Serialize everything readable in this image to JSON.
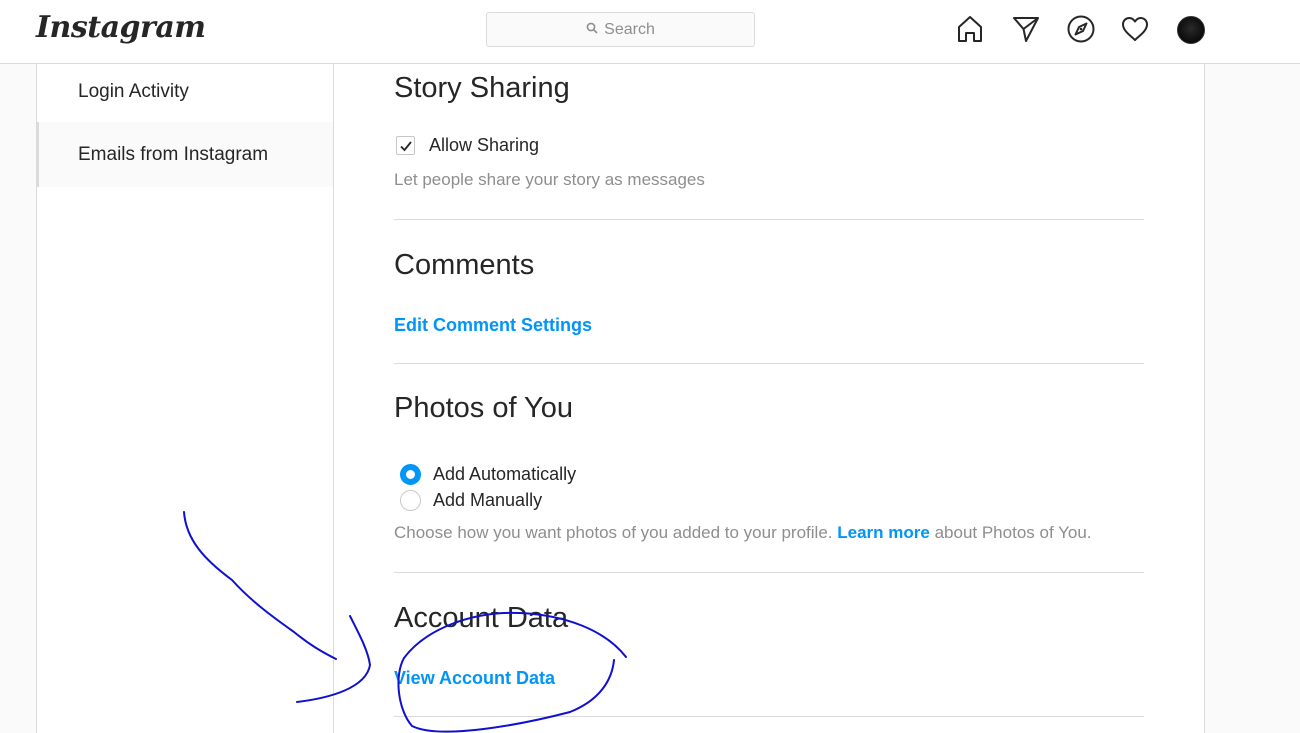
{
  "header": {
    "logo": "Instagram",
    "search_placeholder": "Search",
    "icons": [
      "home-icon",
      "direct-message-icon",
      "explore-icon",
      "activity-heart-icon",
      "profile-avatar"
    ]
  },
  "sidebar": {
    "items": [
      {
        "label": "Login Activity"
      },
      {
        "label": "Emails from Instagram"
      }
    ]
  },
  "sections": {
    "story_sharing": {
      "title": "Story Sharing",
      "checkbox_label": "Allow Sharing",
      "checked": true,
      "help": "Let people share your story as messages"
    },
    "comments": {
      "title": "Comments",
      "link": "Edit Comment Settings"
    },
    "photos_of_you": {
      "title": "Photos of You",
      "options": [
        {
          "label": "Add Automatically",
          "selected": true
        },
        {
          "label": "Add Manually",
          "selected": false
        }
      ],
      "help_before": "Choose how you want photos of you added to your profile.",
      "help_link": "Learn more",
      "help_after": "about Photos of You."
    },
    "account_data": {
      "title": "Account Data",
      "link": "View Account Data"
    }
  },
  "colors": {
    "accent": "#0095f6",
    "annotation": "#1010d0"
  }
}
